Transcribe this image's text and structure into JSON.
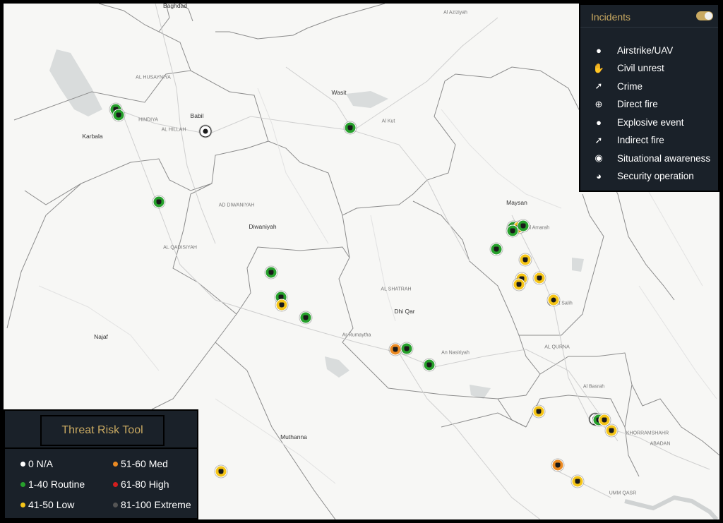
{
  "colors": {
    "na": "#ffffff",
    "routine": "#27a02c",
    "low": "#f5c518",
    "med": "#ea8a23",
    "high": "#d21e1e",
    "extreme": "#555555",
    "accent": "#c9a961",
    "panel": "#1a2129"
  },
  "incidents": {
    "title": "Incidents",
    "toggle_on": true,
    "items": [
      {
        "label": "Airstrike/UAV",
        "icon": "bomb-icon"
      },
      {
        "label": "Civil unrest",
        "icon": "fist-icon"
      },
      {
        "label": "Crime",
        "icon": "knife-icon"
      },
      {
        "label": "Direct fire",
        "icon": "crosshair-icon"
      },
      {
        "label": "Explosive event",
        "icon": "grenade-icon"
      },
      {
        "label": "Indirect fire",
        "icon": "mortar-icon"
      },
      {
        "label": "Situational awareness",
        "icon": "location-pin-icon"
      },
      {
        "label": "Security operation",
        "icon": "helmet-icon"
      }
    ]
  },
  "threat": {
    "title": "Threat Risk Tool",
    "levels": [
      {
        "label": "0 N/A",
        "color": "#ffffff"
      },
      {
        "label": "51-60 Med",
        "color": "#ea8a23"
      },
      {
        "label": "1-40 Routine",
        "color": "#27a02c"
      },
      {
        "label": "61-80 High",
        "color": "#d21e1e"
      },
      {
        "label": "41-50 Low",
        "color": "#f5c518"
      },
      {
        "label": "81-100 Extreme",
        "color": "#555555"
      }
    ]
  },
  "map": {
    "places": {
      "baghdad": "Baghdad",
      "babil": "Babil",
      "karbala": "Karbala",
      "wasit": "Wasit",
      "alhillah": "AL HILLAH",
      "diwaniyah": "Diwaniyah",
      "addiwaniyah": "AD DIWANIYAH",
      "alqadisiyah": "AL QADISIYAH",
      "najaf": "Najaf",
      "maysan": "Maysan",
      "dhiqar": "Dhi Qar",
      "alqurna": "AL QURNA",
      "muthanna": "Muthanna",
      "khorramshahr": "KHORRAMSHAHR",
      "abadan": "ABADAN",
      "umqasr": "UMM QASR",
      "hindiya": "HINDIYA",
      "alhusayniya": "AL HUSAYNIYA",
      "alkut": "Al Kut",
      "alamarah": "Al Amarah",
      "annasiriyah": "An Nasiriyah",
      "alshatrah": "AL SHATRAH",
      "albasrah": "Al Basrah",
      "alrumaytha": "Ar Rumaytha",
      "alaziziyah": "Al Aziziyah",
      "qalatsalih": "Qal'at Salih"
    }
  }
}
